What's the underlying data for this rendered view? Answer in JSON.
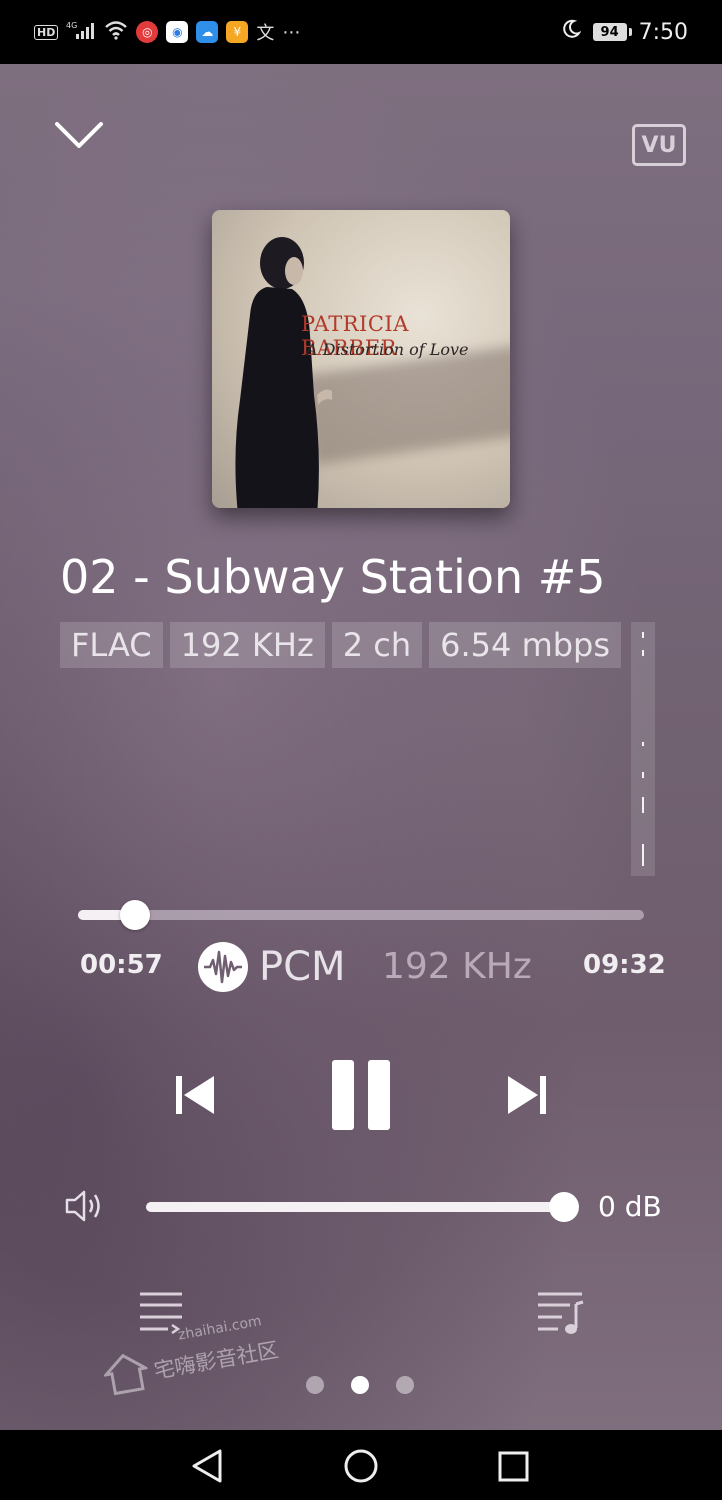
{
  "status_bar": {
    "left_icons": [
      "hd-icon",
      "4g-signal-icon",
      "wifi-icon",
      "app-notification-icon",
      "browser-icon",
      "weather-icon",
      "wallet-icon",
      "translate-icon",
      "more-icon"
    ],
    "battery": "94",
    "time": "7:50"
  },
  "header": {
    "vu_label": "VU"
  },
  "album": {
    "artist": "PATRICIA BARBER",
    "title": "A Distortion of Love"
  },
  "track": {
    "title": "02 - Subway Station #5",
    "tags": [
      "FLAC",
      "192 KHz",
      "2 ch",
      "6.54 mbps"
    ]
  },
  "progress": {
    "elapsed": "00:57",
    "total": "09:32",
    "fraction": 0.1,
    "output_format": "PCM",
    "output_rate": "192 KHz"
  },
  "volume": {
    "value": "0 dB",
    "fraction": 1.0
  },
  "pager": {
    "count": 3,
    "active": 1
  },
  "watermark": {
    "url": "zhaihai.com",
    "name": "宅嗨影音社区"
  },
  "colors": {
    "accent": "#ffffff",
    "background": "#766878",
    "status_bar": "#000000"
  }
}
